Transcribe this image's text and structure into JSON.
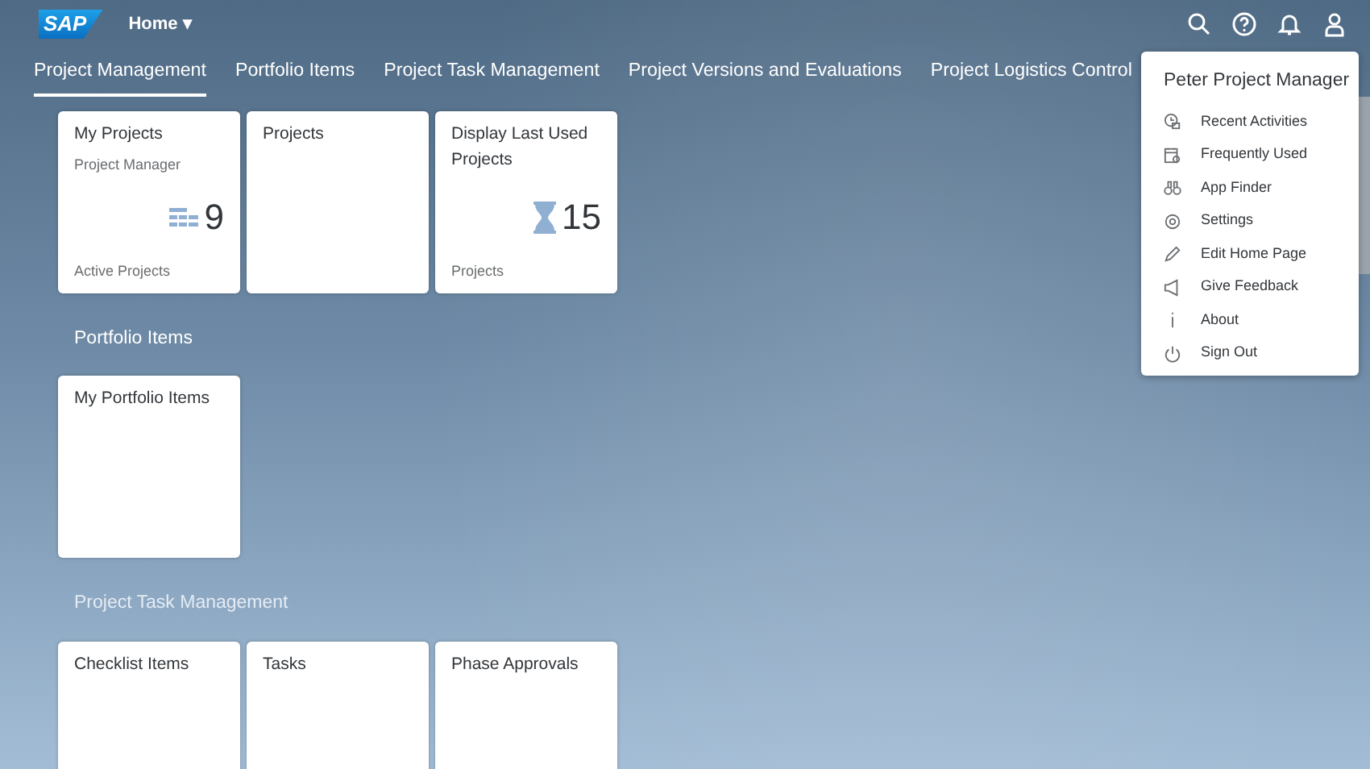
{
  "shell": {
    "logo": "SAP",
    "title": "Home",
    "title_menu": "▾"
  },
  "tabs": [
    {
      "label": "Project Management",
      "selected": true
    },
    {
      "label": "Portfolio Items",
      "selected": false
    },
    {
      "label": "Project Task Management",
      "selected": false
    },
    {
      "label": "Project Versions and Evaluations",
      "selected": false
    },
    {
      "label": "Project Logistics Control",
      "selected": false
    }
  ],
  "sections": [
    {
      "tiles": [
        {
          "kind": "list-count",
          "title": "My Projects",
          "subtitle": "Project Manager",
          "value": "9",
          "footer": "Active Projects"
        },
        {
          "kind": "plain",
          "title": "Projects"
        },
        {
          "kind": "hourglass-count",
          "title": "Display Last Used Projects",
          "value": "15",
          "footer": "Projects"
        }
      ]
    },
    {
      "title": "Portfolio Items",
      "tiles": [
        {
          "kind": "plain",
          "title": "My Portfolio Items"
        }
      ]
    },
    {
      "title": "Project Task Management",
      "tiles": [
        {
          "kind": "plain",
          "title": "Checklist Items"
        },
        {
          "kind": "plain",
          "title": "Tasks"
        },
        {
          "kind": "plain",
          "title": "Phase Approvals"
        }
      ]
    }
  ],
  "user_menu": {
    "name": "Peter Project Manager",
    "items": [
      {
        "label": "Recent Activities"
      },
      {
        "label": "Frequently Used"
      },
      {
        "label": "App Finder"
      },
      {
        "label": "Settings"
      },
      {
        "label": "Edit Home Page"
      },
      {
        "label": "Give Feedback"
      },
      {
        "label": "About"
      },
      {
        "label": "Sign Out"
      }
    ]
  }
}
